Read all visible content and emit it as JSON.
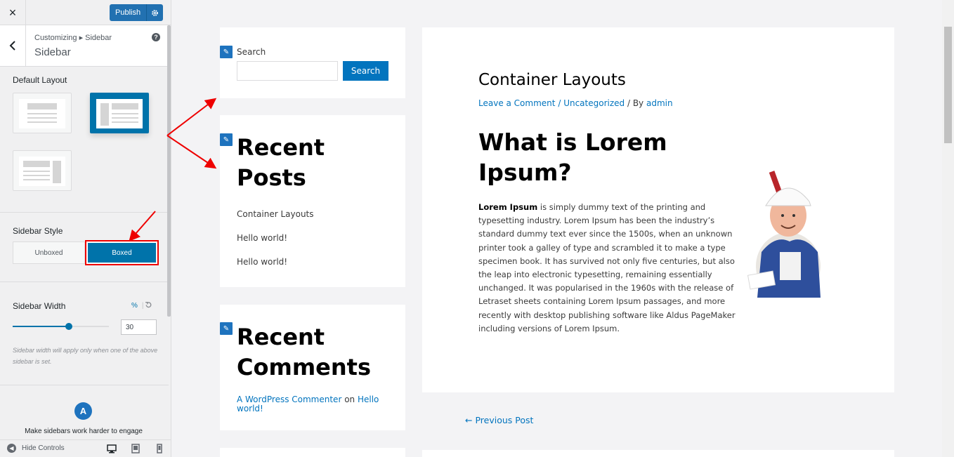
{
  "customizer": {
    "close_icon": "×",
    "publish_label": "Publish",
    "breadcrumb": "Customizing ▸ Sidebar",
    "title": "Sidebar",
    "help_icon": "?",
    "default_layout_label": "Default Layout",
    "sidebar_style_label": "Sidebar Style",
    "style_unboxed": "Unboxed",
    "style_boxed": "Boxed",
    "style_selected": "Boxed",
    "sidebar_width_label": "Sidebar Width",
    "width_unit": "%",
    "width_value": "30",
    "width_fraction": 0.3,
    "width_desc": "Sidebar width will apply only when one of the above sidebar is set.",
    "promo_logo": "A",
    "promo_text": "Make sidebars work harder to engage",
    "hide_controls": "Hide Controls",
    "colors": {
      "accent": "#0073aa",
      "highlight": "#e00000"
    }
  },
  "preview": {
    "search_widget": {
      "label": "Search",
      "button": "Search"
    },
    "recent_posts": {
      "title": "Recent Posts",
      "items": [
        "Container Layouts",
        "Hello world!",
        "Hello world!"
      ]
    },
    "recent_comments": {
      "title": "Recent Comments",
      "author": "A WordPress Commenter",
      "on": "on",
      "post": "Hello world!"
    },
    "article": {
      "title": "Container Layouts",
      "meta_comment": "Leave a Comment",
      "meta_sep": "/",
      "meta_category": "Uncategorized",
      "meta_by": "/ By",
      "meta_author": "admin",
      "heading": "What is Lorem Ipsum?",
      "lead_bold": "Lorem Ipsum",
      "body": " is simply dummy text of the printing and typesetting industry. Lorem Ipsum has been the industry’s standard dummy text ever since the 1500s, when an unknown printer took a galley of type and scrambled it to make a type specimen book. It has survived not only five centuries, but also the leap into electronic typesetting, remaining essentially unchanged. It was popularised in the 1960s with the release of Letraset sheets containing Lorem Ipsum passages, and more recently with desktop publishing software like Aldus PageMaker including versions of Lorem Ipsum."
    },
    "prev_post": "← Previous Post"
  }
}
